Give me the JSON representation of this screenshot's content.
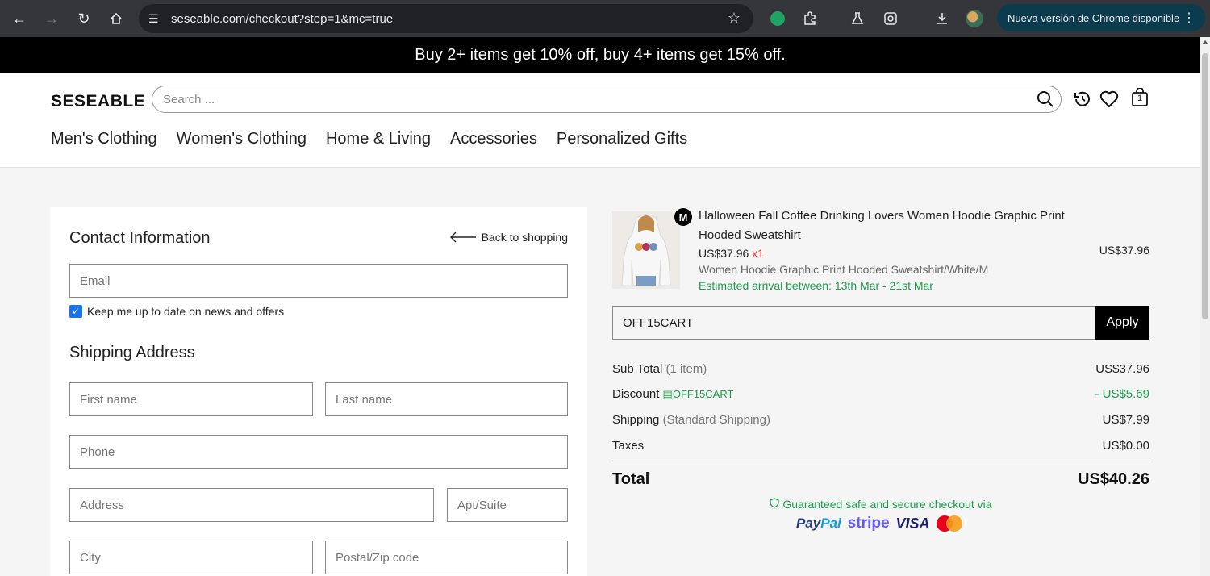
{
  "browser": {
    "url": "seseable.com/checkout?step=1&mc=true",
    "update_label": "Nueva versión de Chrome disponible",
    "menu_dots": "⋮"
  },
  "promo": "Buy 2+ items get 10% off, buy 4+ items get 15% off.",
  "header": {
    "logo": "SESEABLE",
    "search_placeholder": "Search ...",
    "cart_count": "1",
    "menu": [
      "Men's Clothing",
      "Women's Clothing",
      "Home & Living",
      "Accessories",
      "Personalized Gifts"
    ]
  },
  "contact": {
    "title": "Contact Information",
    "back_label": "Back to shopping",
    "email_placeholder": "Email",
    "newsletter_label": "Keep me up to date on news and offers",
    "newsletter_checked": true
  },
  "shipping": {
    "title": "Shipping Address",
    "first_name": "First name",
    "last_name": "Last name",
    "phone": "Phone",
    "address": "Address",
    "apt": "Apt/Suite",
    "city": "City",
    "zip": "Postal/Zip code"
  },
  "order": {
    "badge": "M",
    "product_title": "Halloween Fall Coffee Drinking Lovers Women Hoodie Graphic Print Hooded Sweatshirt",
    "unit_price": "US$37.96",
    "qty": "x1",
    "variant": "Women Hoodie Graphic Print Hooded Sweatshirt/White/M",
    "arrival": "Estimated arrival between: 13th Mar - 21st Mar",
    "line_total": "US$37.96",
    "coupon_value": "OFF15CART",
    "apply_label": "Apply",
    "subtotal_label": "Sub Total",
    "subtotal_note": "(1 item)",
    "subtotal_value": "US$37.96",
    "discount_label": "Discount",
    "discount_code": "OFF15CART",
    "discount_value": "- US$5.69",
    "shipping_label": "Shipping",
    "shipping_note": "(Standard Shipping)",
    "shipping_value": "US$7.99",
    "taxes_label": "Taxes",
    "taxes_value": "US$0.00",
    "total_label": "Total",
    "total_value": "US$40.26",
    "secure_text": "Guaranteed safe and secure checkout via",
    "payment_logos": [
      "PayPal",
      "stripe",
      "VISA",
      "mastercard"
    ]
  },
  "colors": {
    "accent_green": "#1b9e4b",
    "discount_red": "#e53935",
    "checkbox_blue": "#1a73e8"
  }
}
